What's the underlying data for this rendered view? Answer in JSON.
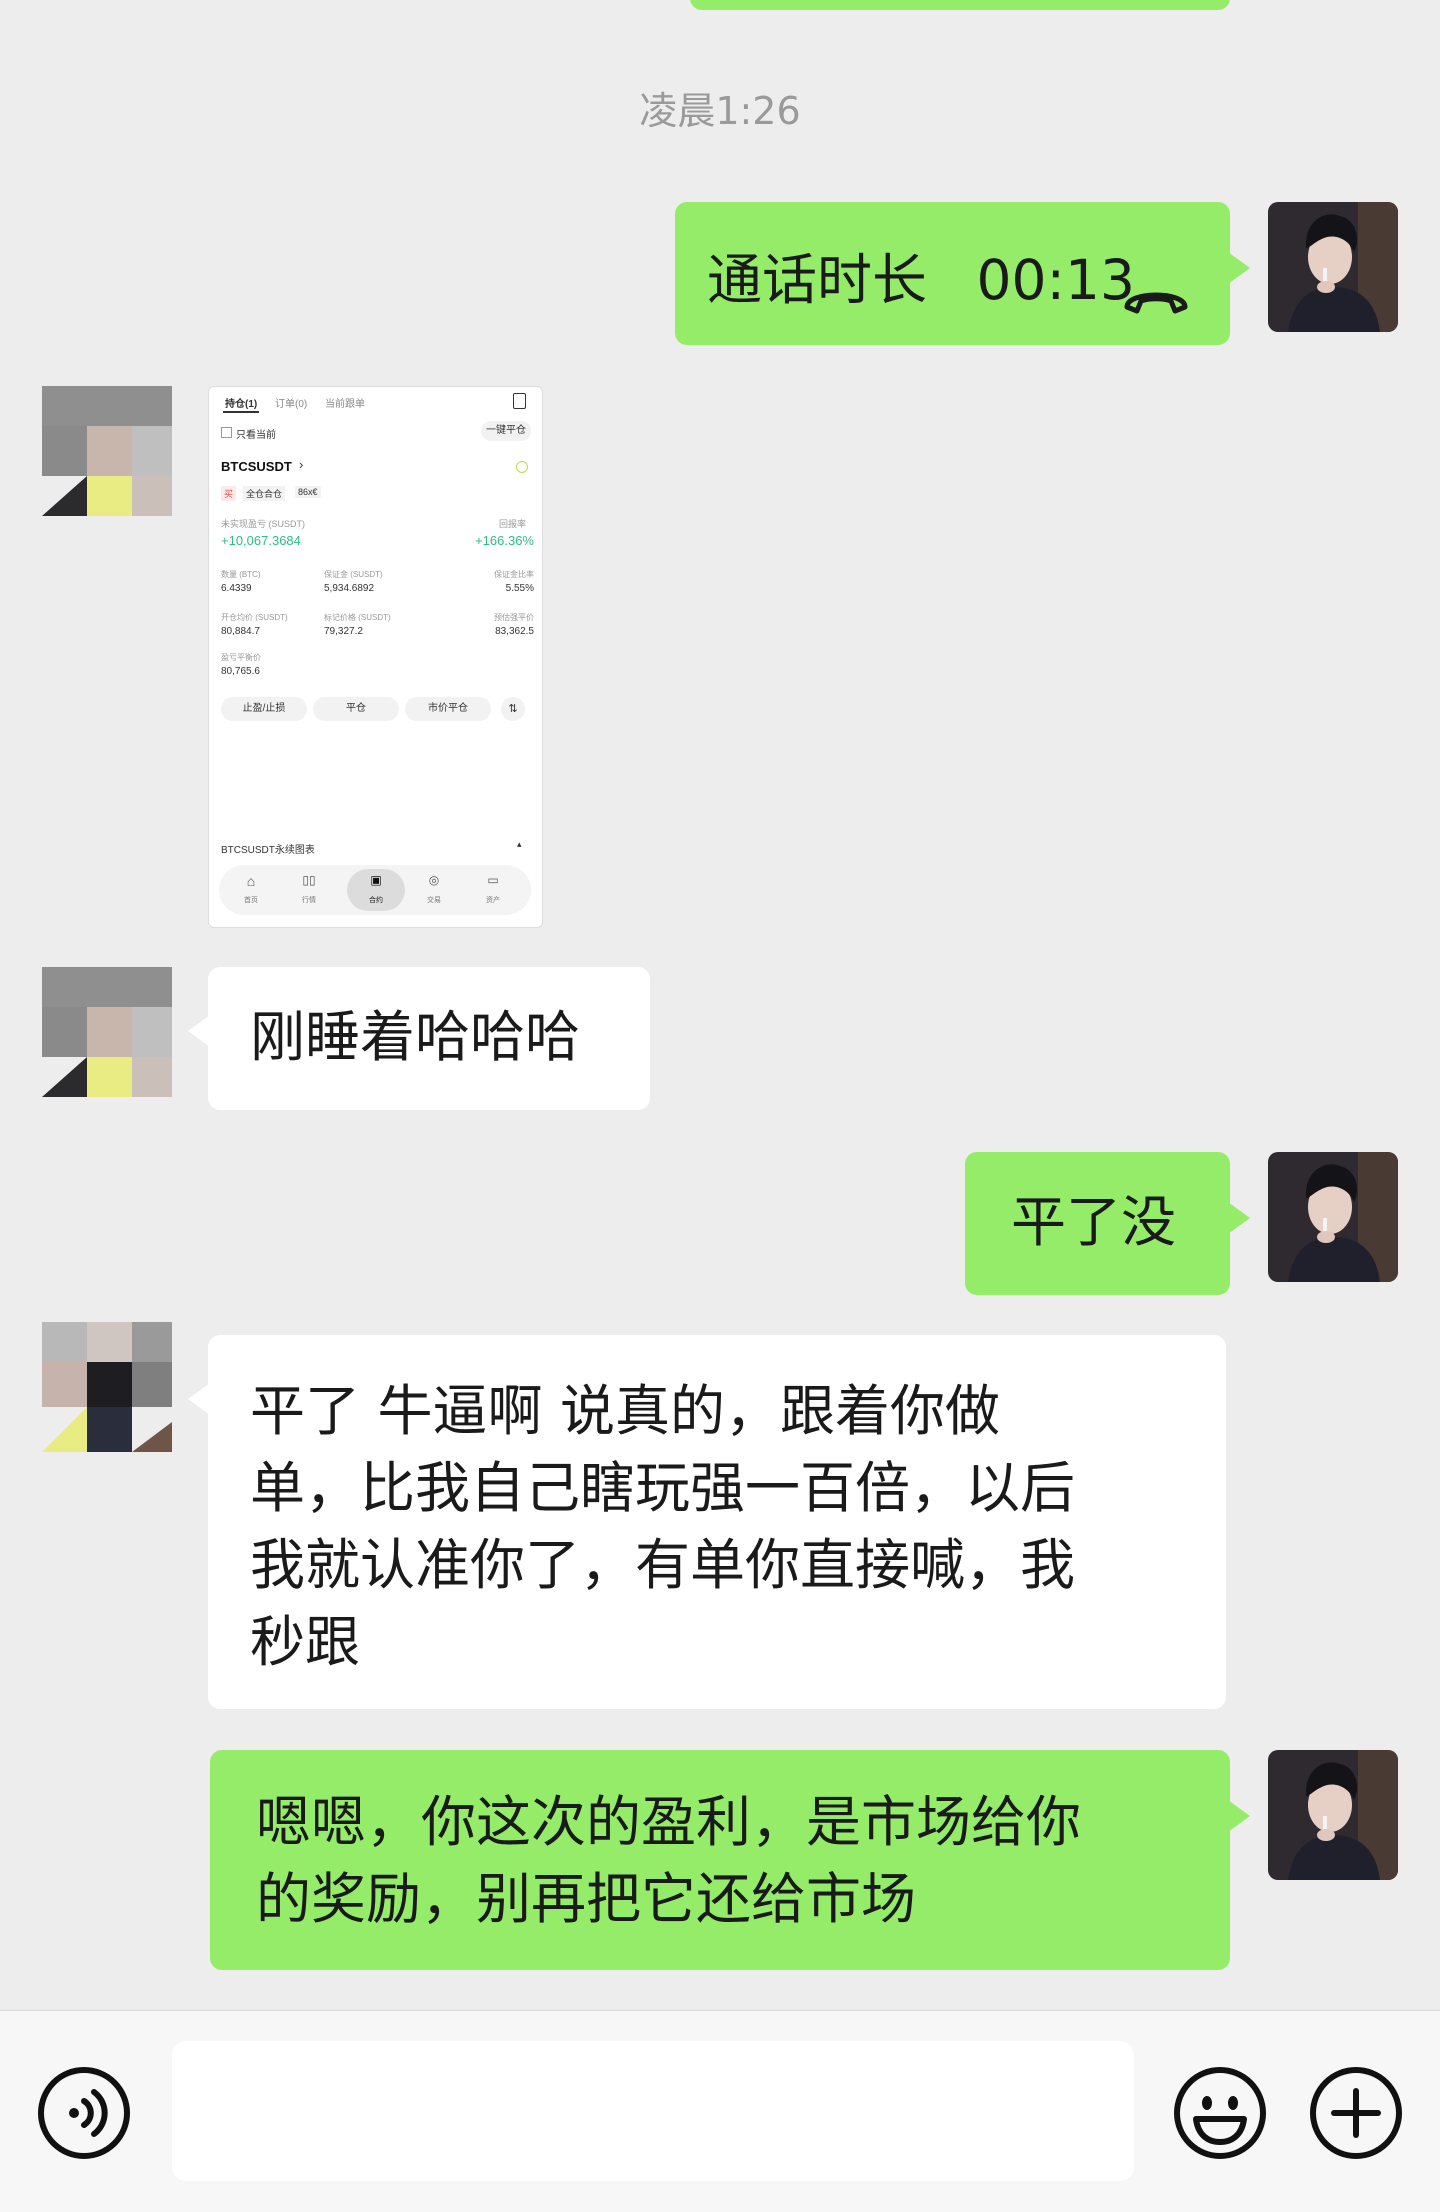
{
  "timestamp": "凌晨1:26",
  "call_message": {
    "label": "通话时长",
    "duration": "00:13",
    "icon": "phone-hangup-icon"
  },
  "messages": {
    "reply_sleep": "刚睡着哈哈哈",
    "ask_close": "平了没",
    "reply_long": [
      "平了  牛逼啊 说真的，跟着你做",
      "单，比我自己瞎玩强一百倍，以后",
      "我就认准你了，有单你直接喊，我",
      "秒跟"
    ],
    "me_final": [
      "嗯嗯，你这次的盈利，是市场给你",
      "的奖励，别再把它还给市场"
    ]
  },
  "screenshot": {
    "tabs": [
      "持仓(1)",
      "订单(0)",
      "当前跟单"
    ],
    "only_current": "只看当前",
    "close_all_btn": "一键平仓",
    "symbol": "BTCSUSDT",
    "tags": [
      "买",
      "全仓合仓",
      "86x€"
    ],
    "pnl_label": "未实现盈亏 (SUSDT)",
    "roe_label": "回报率",
    "pnl_value": "+10,067.3684",
    "roe_value": "+166.36%",
    "row1_labels": [
      "数量 (BTC)",
      "保证金 (SUSDT)",
      "保证金比率"
    ],
    "row1_values": [
      "6.4339",
      "5,934.6892",
      "5.55%"
    ],
    "row2_labels": [
      "开仓均价 (SUSDT)",
      "标记价格 (SUSDT)",
      "预估强平价"
    ],
    "row2_values": [
      "80,884.7",
      "79,327.2",
      "83,362.5"
    ],
    "row3_label": "盈亏平衡价",
    "row3_value": "80,765.6",
    "buttons": [
      "止盈/止损",
      "平仓",
      "市价平仓"
    ],
    "chart_link": "BTCSUSDT永续图表",
    "nav": [
      "首页",
      "行情",
      "合约",
      "交易",
      "资产"
    ]
  },
  "input_bar": {
    "value": ""
  },
  "colors": {
    "me_bubble": "#95ec69",
    "other_bubble": "#ffffff",
    "background": "#ededed",
    "profit": "#2ebd85"
  }
}
